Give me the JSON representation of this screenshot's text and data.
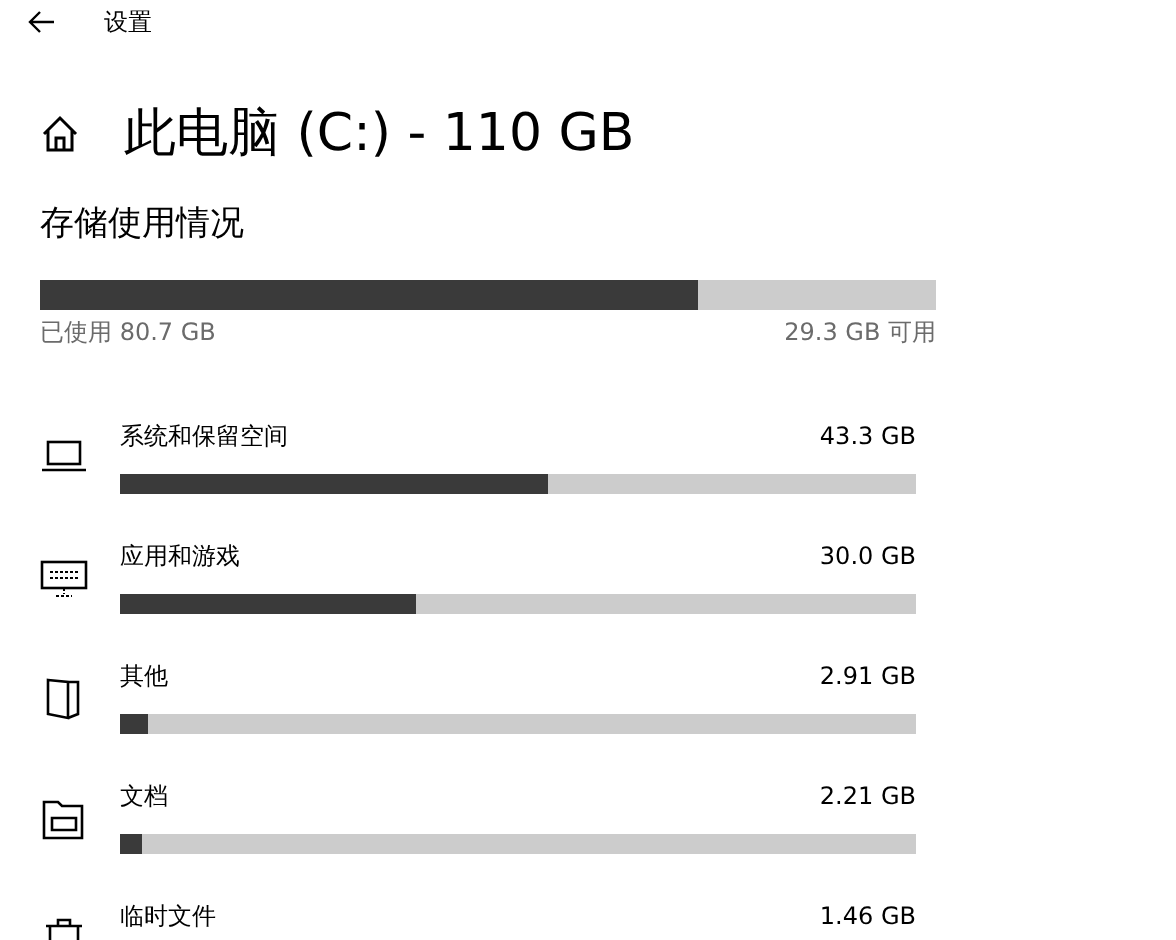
{
  "window": {
    "title": "设置"
  },
  "header": {
    "title": "此电脑 (C:) - 110 GB"
  },
  "storage": {
    "heading": "存储使用情况",
    "level": 0.734,
    "used": "已使用 80.7 GB",
    "free": "29.3 GB 可用"
  },
  "categories": [
    {
      "kind": "laptop",
      "name": "系统和保留空间",
      "size": "43.3 GB",
      "level": 0.538
    },
    {
      "kind": "keyboard",
      "name": "应用和游戏",
      "size": "30.0 GB",
      "level": 0.372
    },
    {
      "kind": "other",
      "name": "其他",
      "size": "2.91 GB",
      "level": 0.035
    },
    {
      "kind": "folder",
      "name": "文档",
      "size": "2.21 GB",
      "level": 0.028
    },
    {
      "kind": "trash",
      "name": "临时文件",
      "size": "1.46 GB"
    }
  ]
}
